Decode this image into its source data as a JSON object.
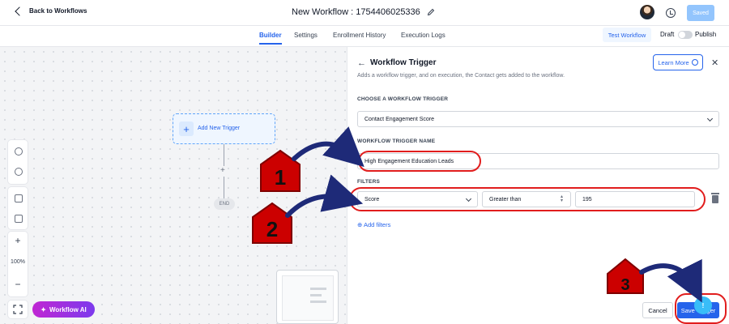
{
  "header": {
    "back_label": "Back to Workflows",
    "workflow_title": "New Workflow : 1754406025336",
    "saved_label": "Saved"
  },
  "tabs": [
    {
      "label": "Builder",
      "active": true
    },
    {
      "label": "Settings",
      "active": false
    },
    {
      "label": "Enrollment History",
      "active": false
    },
    {
      "label": "Execution Logs",
      "active": false
    }
  ],
  "actions": {
    "test_workflow": "Test Workflow",
    "draft": "Draft",
    "publish": "Publish"
  },
  "canvas": {
    "add_trigger": "Add New Trigger",
    "end": "END",
    "zoom_level": "100%",
    "workflow_ai": "Workflow AI"
  },
  "panel": {
    "title": "Workflow Trigger",
    "description": "Adds a workflow trigger, and on execution, the Contact gets added to the workflow.",
    "learn_more": "Learn More",
    "choose_label": "CHOOSE A WORKFLOW TRIGGER",
    "trigger_value": "Contact Engagement Score",
    "name_label": "WORKFLOW TRIGGER NAME",
    "name_value": "High Engagement Education Leads",
    "filters_label": "FILTERS",
    "filter": {
      "field": "Score",
      "operator": "Greater than",
      "value": "195"
    },
    "add_filters": "Add filters",
    "cancel": "Cancel",
    "save": "Save Trigger"
  },
  "annotations": [
    "1",
    "2",
    "3"
  ],
  "colors": {
    "accent": "#2563eb",
    "annotation_red": "#e11d1d",
    "arrow_navy": "#1e2a78"
  }
}
